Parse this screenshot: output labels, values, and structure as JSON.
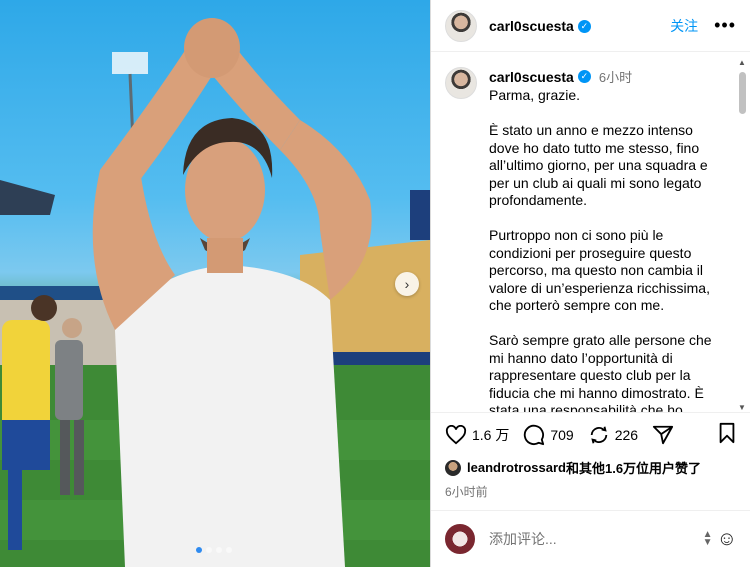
{
  "header": {
    "username": "carl0scuesta",
    "follow_label": "关注",
    "more_label": "•••"
  },
  "post": {
    "username": "carl0scuesta",
    "time": "6小时",
    "caption": "Parma, grazie.\n\nÈ stato un anno e mezzo intenso dove ho dato tutto me stesso, fino all’ultimo giorno, per una squadra e per un club ai quali mi sono legato profondamente.\n\nPurtroppo non ci sono più le condizioni per proseguire questo percorso, ma questo non cambia il valore di un’esperienza ricchissima, che porterò sempre con me.\n\nSarò sempre grato alle persone che mi hanno dato l’opportunità di rappresentare questo club per la fiducia che mi hanno dimostrato. È stata una responsabilità che ho"
  },
  "actions": {
    "likes": "1.6 万",
    "comments": "709",
    "reposts": "226"
  },
  "liked_by": {
    "user": "leandrotrossard",
    "text": "和其他1.6万位用户赞了"
  },
  "posted_ago": "6小时前",
  "comment_box": {
    "placeholder": "添加评论..."
  },
  "carousel": {
    "total": 4,
    "active": 0
  },
  "colors": {
    "accent": "#0095f6",
    "muted": "#737373"
  }
}
